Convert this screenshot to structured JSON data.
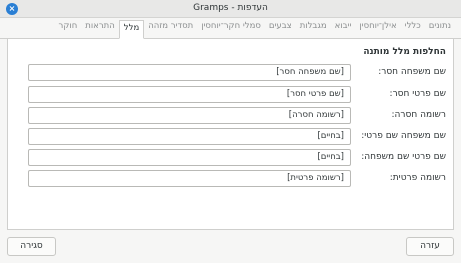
{
  "window": {
    "title": "Gramps - העדפות"
  },
  "tabs": [
    {
      "label": "נתונים"
    },
    {
      "label": "כללי"
    },
    {
      "label": "אילן־יוחסין"
    },
    {
      "label": "ייבוא"
    },
    {
      "label": "מגבלות"
    },
    {
      "label": "צבעים"
    },
    {
      "label": "סמלי חקר־יוחסין"
    },
    {
      "label": "תסדיר מזהה"
    },
    {
      "label": "מלל"
    },
    {
      "label": "התראות"
    },
    {
      "label": "חוקר"
    }
  ],
  "active_tab": "מלל",
  "section_title": "החלפות מלל מותנה",
  "fields": [
    {
      "label": "שם משפחה חסר:",
      "value": "[שם משפחה חסר]"
    },
    {
      "label": "שם פרטי חסר:",
      "value": "[שם פרטי חסר]"
    },
    {
      "label": "רשומה חסרה:",
      "value": "[רשומה חסרה]"
    },
    {
      "label": "שם משפחה שם פרטי:",
      "value": "[בחיים]"
    },
    {
      "label": "שם פרטי שם משפחה:",
      "value": "[בחיים]"
    },
    {
      "label": "רשומה פרטית:",
      "value": "[רשומה פרטית]"
    }
  ],
  "buttons": {
    "close": "סגירה",
    "help": "עזרה"
  }
}
